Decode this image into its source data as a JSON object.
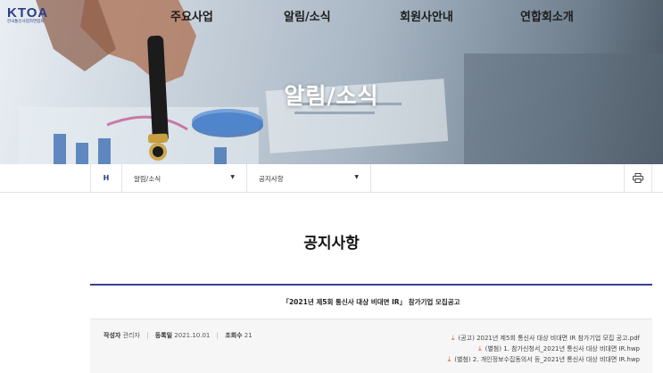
{
  "header": {
    "logo": {
      "text": "KTOA",
      "subtitle": "한국통신사업자연합회"
    },
    "nav": [
      "주요사업",
      "알림/소식",
      "회원사안내",
      "연합회소개"
    ]
  },
  "hero": {
    "title": "알림/소식"
  },
  "breadcrumb": {
    "home_label": "H",
    "level1": "알림/소식",
    "level2": "공지사항",
    "print_icon": "printer-icon"
  },
  "content": {
    "page_title": "공지사항",
    "post_title": "「2021년 제5회 통신사 대상 비대면 IR」 참가기업 모집공고",
    "meta": {
      "author_label": "작성자",
      "author": "관리자",
      "date_label": "등록일",
      "date": "2021.10.01",
      "views_label": "조회수",
      "views": "21"
    },
    "attachments": [
      "(공고) 2021년 제5회 통신사 대상 비대면 IR 참가기업 모집 공고.pdf",
      "(별첨) 1. 참가신청서_2021년 통신사 대상 비대면 IR.hwp",
      "(별첨) 2. 개인정보수집동의서 등_2021년 통신사 대상 비대면 IR.hwp"
    ]
  },
  "colors": {
    "brand": "#2c3c86",
    "accent_rule": "#3a3f8f",
    "download": "#e0522c"
  }
}
